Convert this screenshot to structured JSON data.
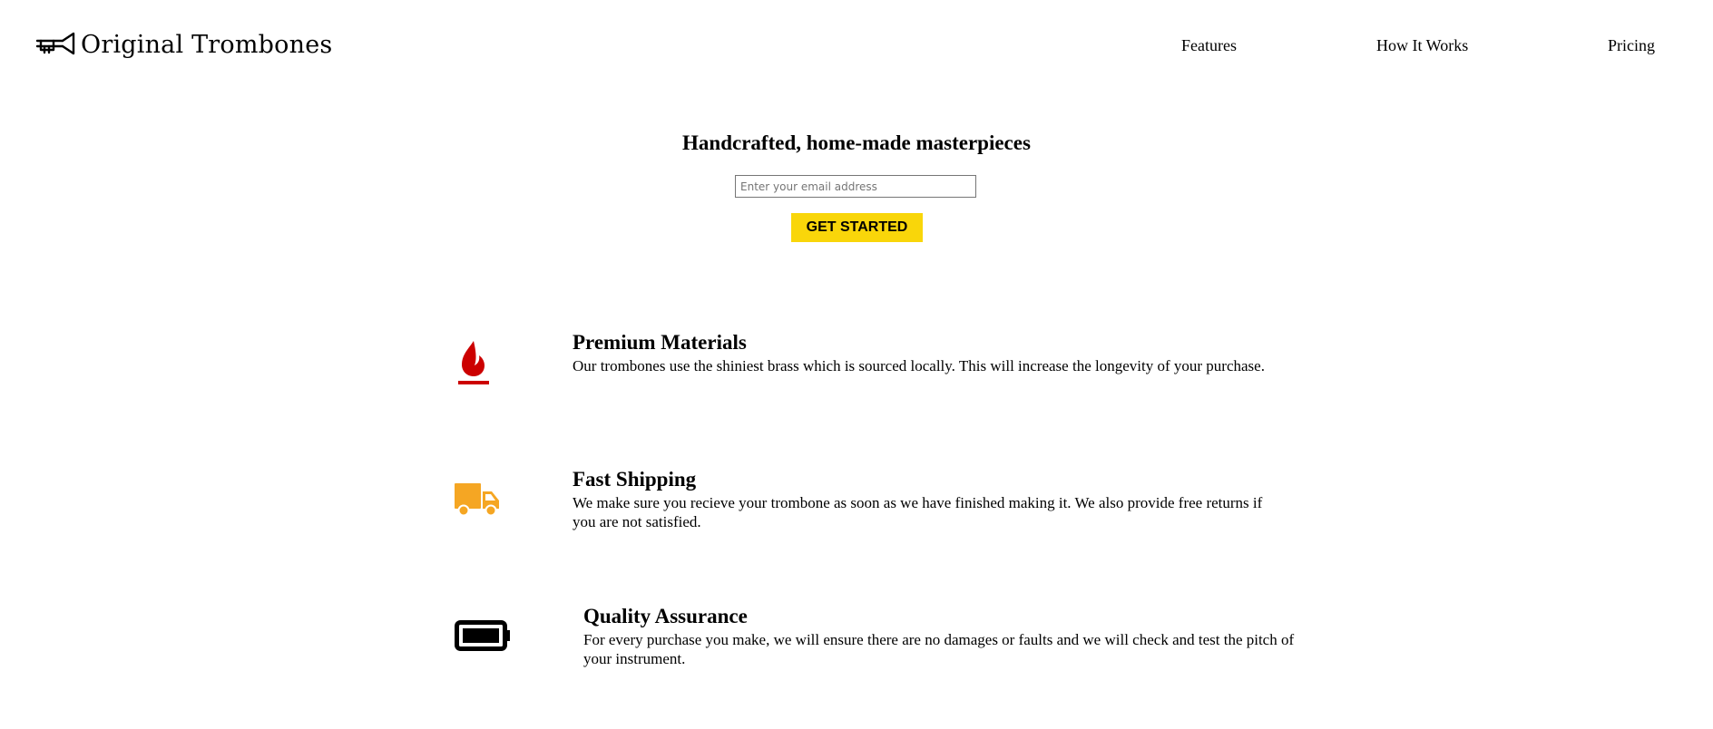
{
  "brand": {
    "name": "Original Trombones",
    "logo_icon": "trombone-icon"
  },
  "nav": {
    "items": [
      {
        "label": "Features"
      },
      {
        "label": "How It Works"
      },
      {
        "label": "Pricing"
      }
    ]
  },
  "hero": {
    "title": "Handcrafted, home-made masterpieces",
    "email_placeholder": "Enter your email address",
    "email_value": "",
    "cta_label": "GET STARTED",
    "cta_color": "#f9d60a"
  },
  "features": [
    {
      "icon": "fire-icon",
      "icon_color": "#cc0000",
      "title": "Premium Materials",
      "description": "Our trombones use the shiniest brass which is sourced locally. This will increase the longevity of your purchase."
    },
    {
      "icon": "truck-icon",
      "icon_color": "#f5a623",
      "title": "Fast Shipping",
      "description": "We make sure you recieve your trombone as soon as we have finished making it. We also provide free returns if you are not satisfied."
    },
    {
      "icon": "battery-full-icon",
      "icon_color": "#000000",
      "title": "Quality Assurance",
      "description": "For every purchase you make, we will ensure there are no damages or faults and we will check and test the pitch of your instrument."
    }
  ]
}
